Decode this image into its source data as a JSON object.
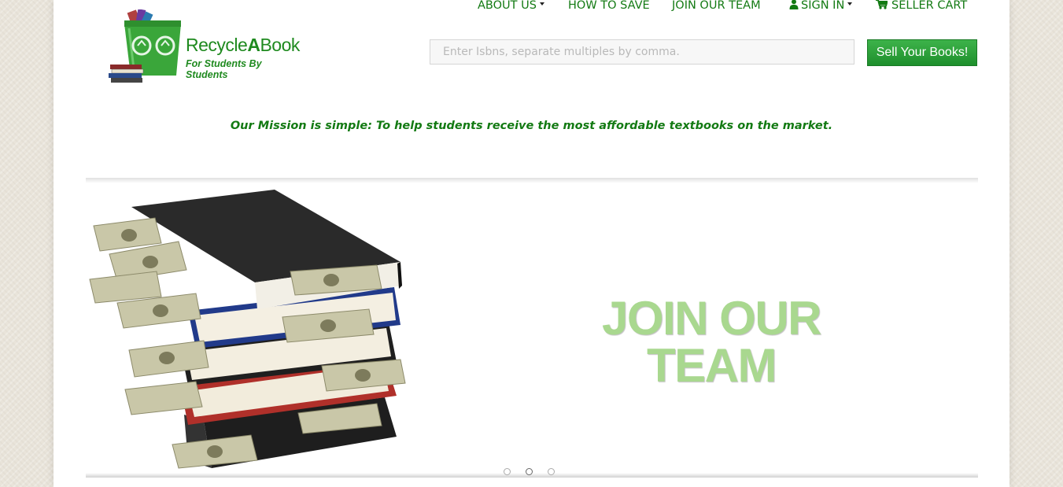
{
  "brand": {
    "name_part1": "Recycle",
    "name_part2": "A",
    "name_part3": "Book",
    "tagline": "For Students By Students",
    "logo_icon": "recycle-bin-with-books",
    "color": "#1f8a1f"
  },
  "nav": {
    "items": [
      {
        "label": "ABOUT US",
        "dropdown": true
      },
      {
        "label": "HOW TO SAVE",
        "dropdown": false
      },
      {
        "label": "JOIN OUR TEAM",
        "dropdown": false
      },
      {
        "label": "SIGN IN",
        "dropdown": true,
        "icon": "user-icon"
      },
      {
        "label": "SELLER CART",
        "dropdown": false,
        "icon": "cart-icon"
      }
    ],
    "color": "#137a13"
  },
  "search": {
    "value": "",
    "placeholder": "Enter Isbns, separate multiples by comma.",
    "button_label": "Sell Your Books!"
  },
  "mission": "Our Mission is simple: To help students receive the most affordable textbooks on the market.",
  "carousel": {
    "slide_title_line1": "JOIN OUR",
    "slide_title_line2": "TEAM",
    "slide_image": "stack-of-books-with-money",
    "indicators": 3,
    "active_index": 1,
    "title_color": "#a9d88f"
  }
}
